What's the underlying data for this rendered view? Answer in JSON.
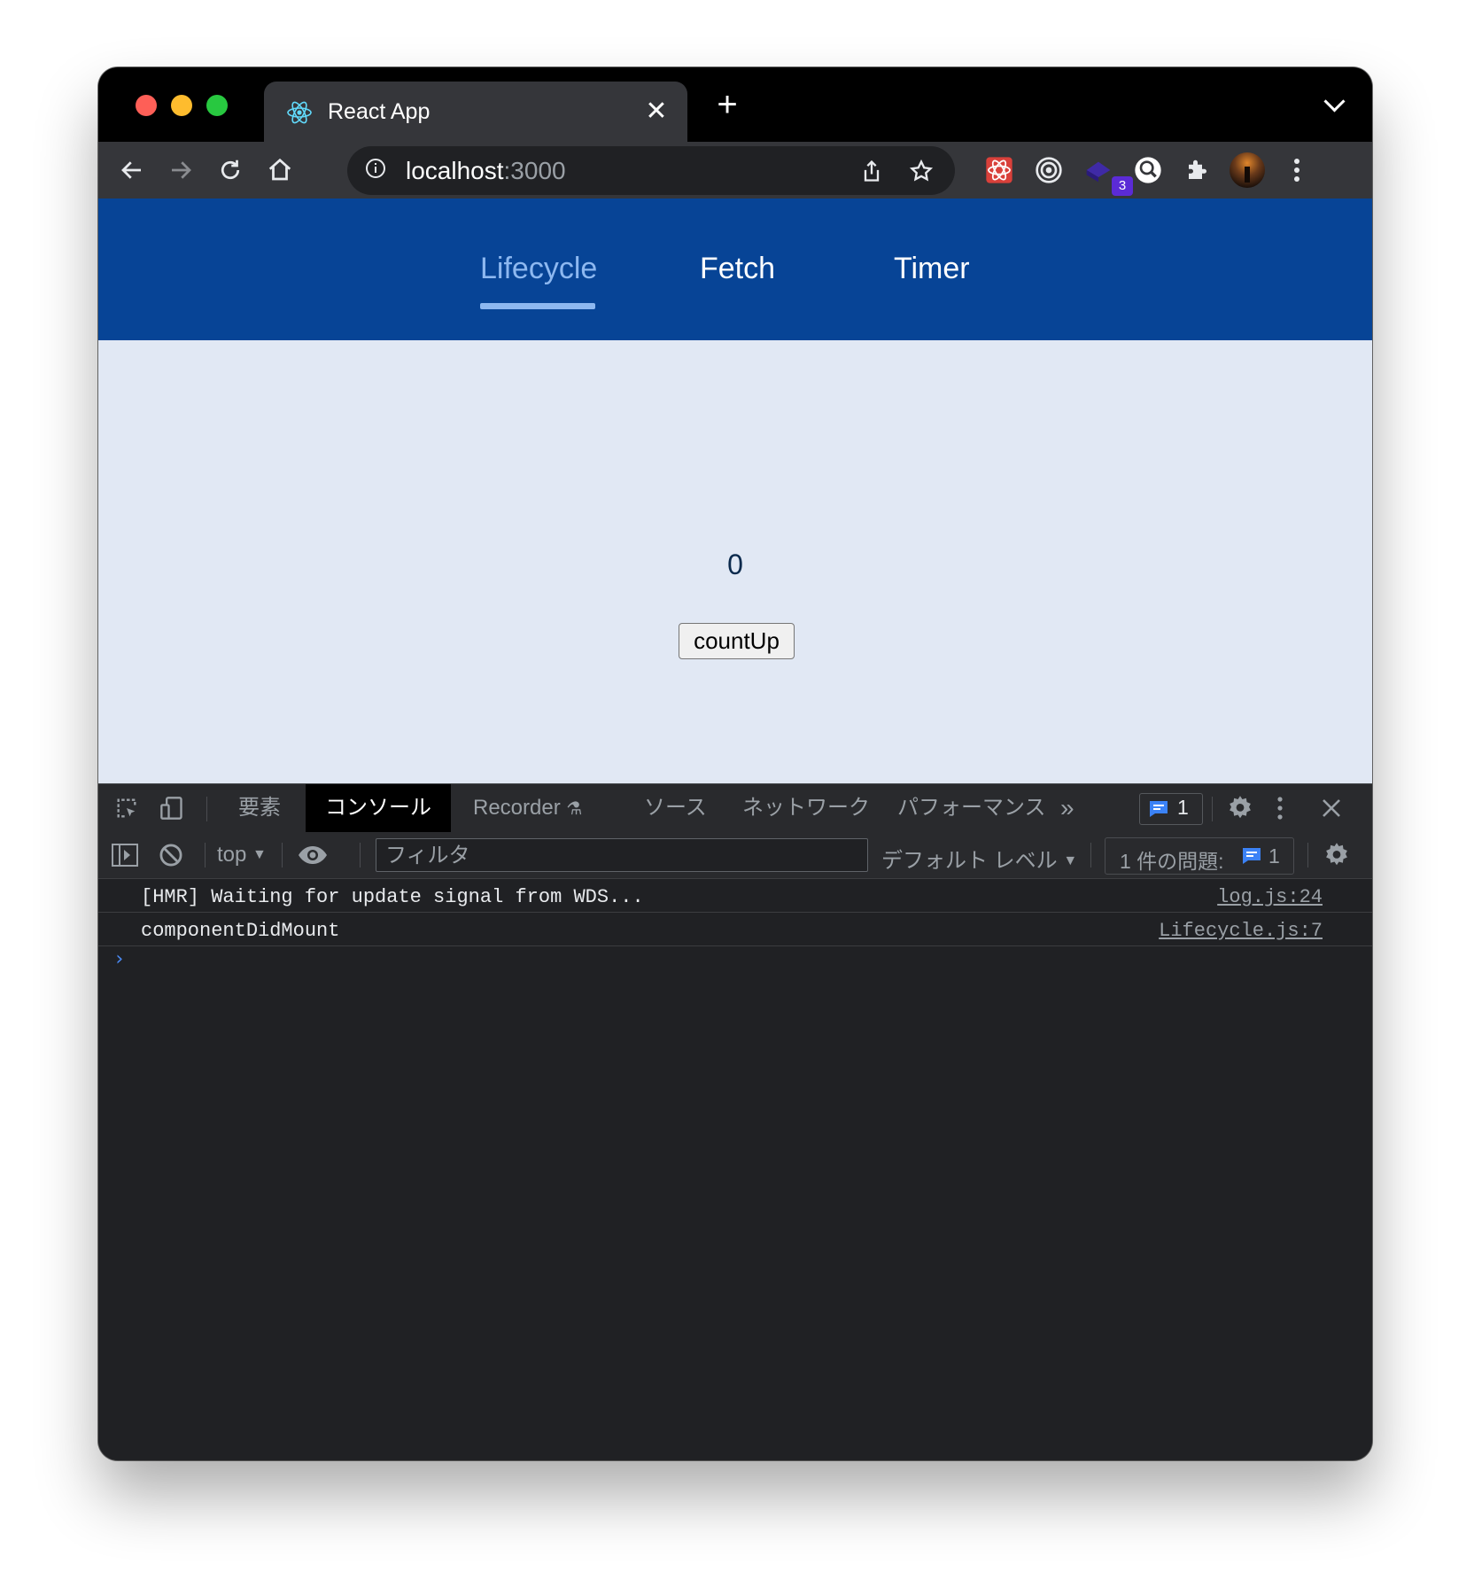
{
  "browser": {
    "tab_title": "React App",
    "url_host": "localhost",
    "url_port": ":3000",
    "extension_badge": "3",
    "colors": {
      "titlebar": "#000000",
      "toolbar": "#35363a",
      "traffic_red": "#fe5f57",
      "traffic_yellow": "#febc2e",
      "traffic_green": "#28c840"
    }
  },
  "nav": {
    "items": [
      {
        "label": "Lifecycle",
        "active": true
      },
      {
        "label": "Fetch",
        "active": false
      },
      {
        "label": "Timer",
        "active": false
      }
    ],
    "colors": {
      "bar": "#074496",
      "active": "#8db8f0"
    }
  },
  "content": {
    "count": "0",
    "button_label": "countUp",
    "background": "#e1e8f4"
  },
  "devtools": {
    "tabs": [
      "要素",
      "コンソール",
      "Recorder",
      "ソース",
      "ネットワーク",
      "パフォーマンス"
    ],
    "active_tab": "コンソール",
    "overflow": "»",
    "issue_badge_count": "1",
    "context": "top",
    "filter_placeholder": "フィルタ",
    "log_level": "デフォルト レベル",
    "issues_label": "1 件の問題:",
    "issues_count": "1",
    "logs": [
      {
        "message": "[HMR] Waiting for update signal from WDS...",
        "source": "log.js:24"
      },
      {
        "message": "componentDidMount",
        "source": "Lifecycle.js:7"
      }
    ],
    "prompt": "›"
  }
}
